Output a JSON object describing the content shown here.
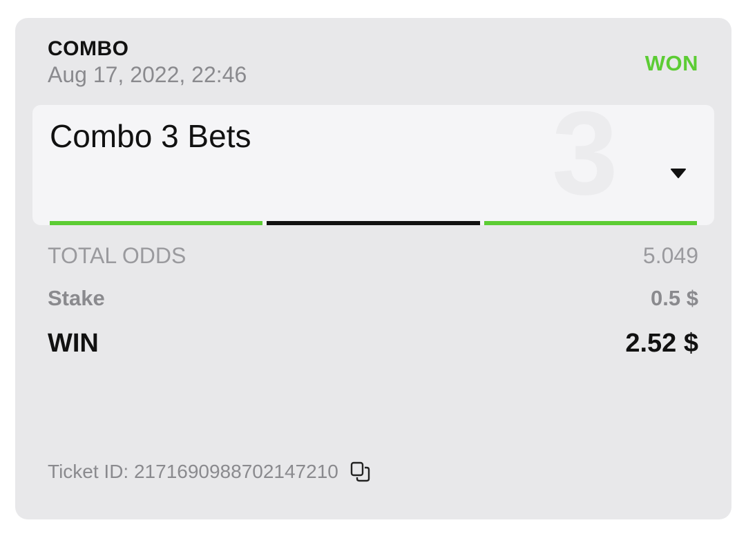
{
  "bet": {
    "type": "COMBO",
    "date": "Aug 17, 2022, 22:46",
    "status": "WON",
    "status_color": "#5ccc34"
  },
  "combo": {
    "title": "Combo 3 Bets",
    "count": "3",
    "dropdown_icon": "caret-down-icon",
    "legs": [
      {
        "result": "won",
        "color": "#5ccc34"
      },
      {
        "result": "lost",
        "color": "#111111"
      },
      {
        "result": "won",
        "color": "#5ccc34"
      }
    ]
  },
  "summary": {
    "total_odds_label": "TOTAL ODDS",
    "total_odds_value": "5.049",
    "stake_label": "Stake",
    "stake_value": "0.5 $",
    "win_label": "WIN",
    "win_value": "2.52 $"
  },
  "ticket": {
    "label": "Ticket ID: 2171690988702147210",
    "copy_icon": "copy-icon"
  }
}
